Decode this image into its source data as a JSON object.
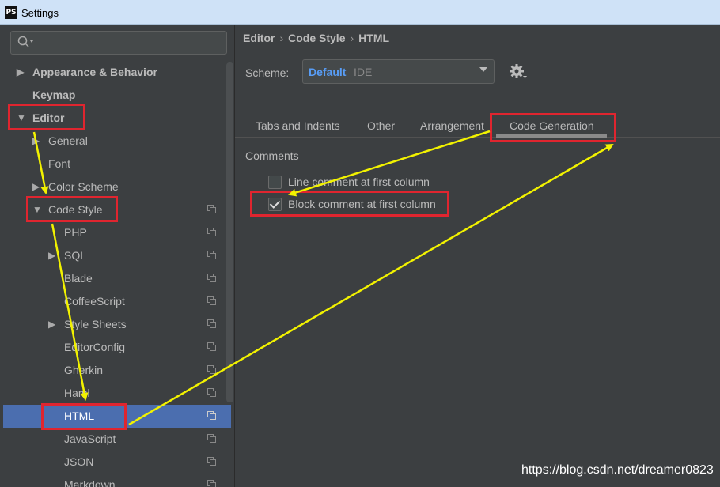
{
  "window": {
    "title": "Settings",
    "app_icon": "PS"
  },
  "search": {
    "placeholder": ""
  },
  "tree": {
    "items": [
      {
        "label": "Appearance & Behavior",
        "arrow": "▶"
      },
      {
        "label": "Keymap",
        "arrow": ""
      },
      {
        "label": "Editor",
        "arrow": "▼"
      },
      {
        "label": "General",
        "arrow": "▶"
      },
      {
        "label": "Font",
        "arrow": ""
      },
      {
        "label": "Color Scheme",
        "arrow": "▶"
      },
      {
        "label": "Code Style",
        "arrow": "▼"
      },
      {
        "label": "PHP",
        "arrow": ""
      },
      {
        "label": "SQL",
        "arrow": "▶"
      },
      {
        "label": "Blade",
        "arrow": ""
      },
      {
        "label": "CoffeeScript",
        "arrow": ""
      },
      {
        "label": "Style Sheets",
        "arrow": "▶"
      },
      {
        "label": "EditorConfig",
        "arrow": ""
      },
      {
        "label": "Gherkin",
        "arrow": ""
      },
      {
        "label": "Haml",
        "arrow": ""
      },
      {
        "label": "HTML",
        "arrow": ""
      },
      {
        "label": "JavaScript",
        "arrow": ""
      },
      {
        "label": "JSON",
        "arrow": ""
      },
      {
        "label": "Markdown",
        "arrow": ""
      }
    ]
  },
  "breadcrumb": {
    "items": [
      "Editor",
      "Code Style",
      "HTML"
    ],
    "separator": "›"
  },
  "scheme": {
    "label": "Scheme:",
    "value": "Default",
    "suffix": "IDE"
  },
  "tabs": [
    "Tabs and Indents",
    "Other",
    "Arrangement",
    "Code Generation"
  ],
  "active_tab": "Code Generation",
  "comments": {
    "heading": "Comments",
    "options": [
      {
        "label": "Line comment at first column",
        "checked": false
      },
      {
        "label": "Block comment at first column",
        "checked": true
      }
    ]
  },
  "watermark": "https://blog.csdn.net/dreamer0823",
  "colors": {
    "selection": "#4b6eaf",
    "annotation_red": "#e0252f",
    "annotation_yellow": "#f2f200",
    "accent_blue": "#589df6"
  }
}
